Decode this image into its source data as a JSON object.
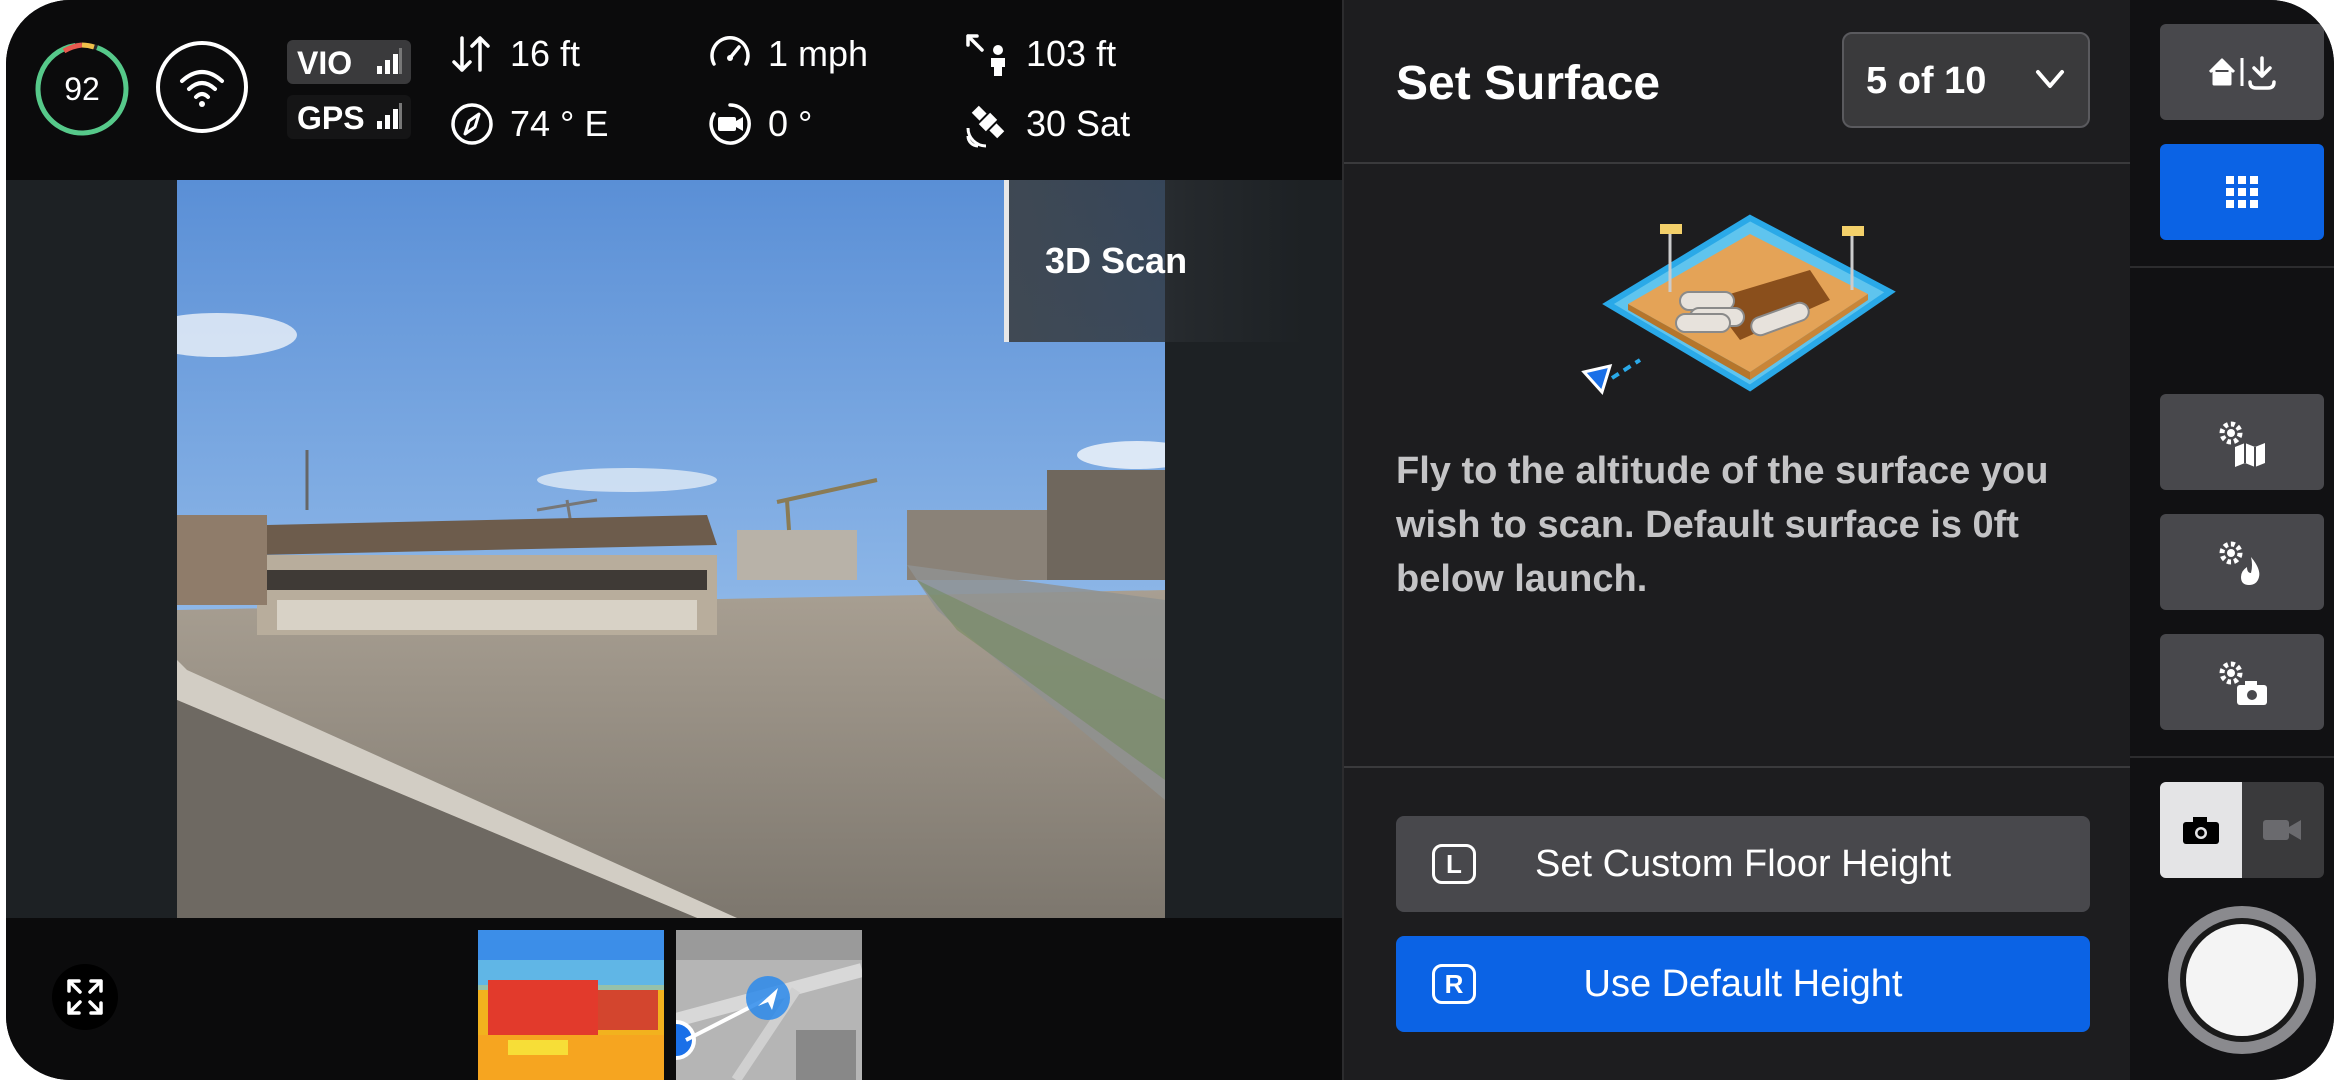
{
  "telemetry": {
    "battery": "92",
    "signals": [
      {
        "label": "VIO",
        "strength": 3
      },
      {
        "label": "GPS",
        "strength": 3
      }
    ],
    "altitude": "16 ft",
    "heading": "74 ° E",
    "speed": "1 mph",
    "gimbal": "0 °",
    "distance": "103 ft",
    "satellites": "30 Sat"
  },
  "camera": {
    "mode_label": "3D Scan"
  },
  "panel": {
    "title": "Set Surface",
    "step": "5 of 10",
    "description": "Fly to the altitude of the surface you wish to scan. Default surface is 0ft below launch.",
    "buttons": [
      {
        "key": "L",
        "label": "Set Custom Floor Height"
      },
      {
        "key": "R",
        "label": "Use Default Height"
      }
    ]
  },
  "colors": {
    "accent": "#0b63e5",
    "battery_ring": "#56c98a",
    "panel_bg": "#1d1d1f",
    "button_gray": "#48484c"
  },
  "rail": {
    "icons": [
      "home-download-icon",
      "grid-icon",
      "map-settings-icon",
      "flame-settings-icon",
      "camera-settings-icon",
      "photo-mode-icon",
      "video-mode-icon"
    ],
    "capture_mode": "photo"
  }
}
